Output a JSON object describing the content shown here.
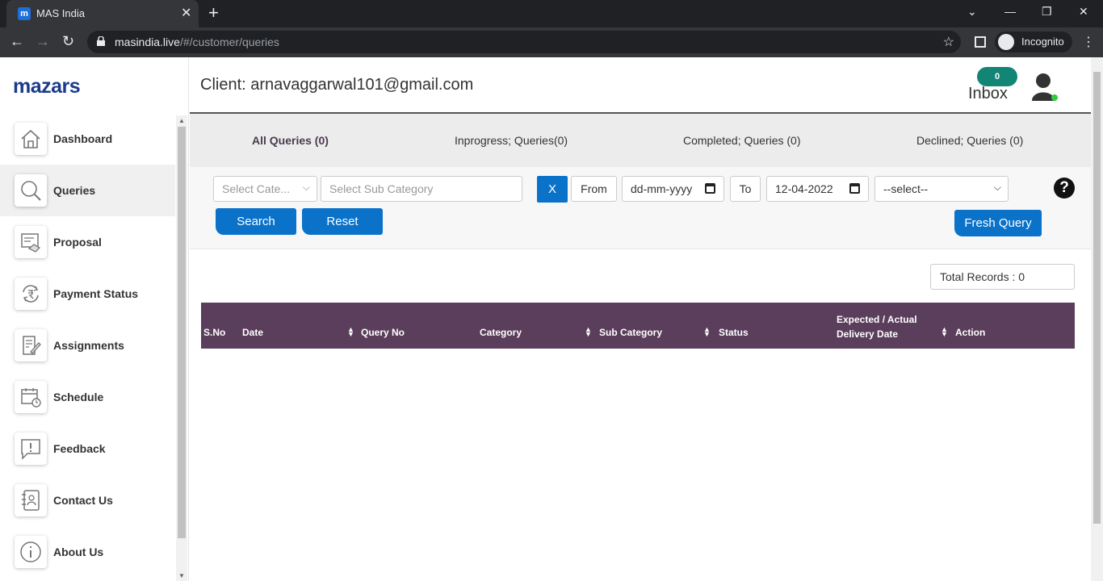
{
  "browser": {
    "tab_title": "MAS India",
    "url_host": "masindia.live",
    "url_path": "/#/customer/queries",
    "profile_label": "Incognito"
  },
  "sidebar": {
    "logo": "mazars",
    "items": [
      {
        "label": "Dashboard",
        "icon": "home-icon"
      },
      {
        "label": "Queries",
        "icon": "search-icon"
      },
      {
        "label": "Proposal",
        "icon": "proposal-icon"
      },
      {
        "label": "Payment Status",
        "icon": "rupee-refresh-icon"
      },
      {
        "label": "Assignments",
        "icon": "edit-document-icon"
      },
      {
        "label": "Schedule",
        "icon": "calendar-clock-icon"
      },
      {
        "label": "Feedback",
        "icon": "feedback-icon"
      },
      {
        "label": "Contact Us",
        "icon": "contact-book-icon"
      },
      {
        "label": "About Us",
        "icon": "info-icon"
      }
    ],
    "active": "Queries"
  },
  "header": {
    "client": "Client: arnavaggarwal101@gmail.com",
    "inbox_count": "0",
    "inbox_label": "Inbox"
  },
  "tabs": [
    {
      "label": "All Queries (0)",
      "active": true
    },
    {
      "label": "Inprogress; Queries(0)",
      "active": false
    },
    {
      "label": "Completed; Queries (0)",
      "active": false
    },
    {
      "label": "Declined; Queries (0)",
      "active": false
    }
  ],
  "filters": {
    "category_placeholder": "Select Cate...",
    "subcategory_placeholder": "Select Sub Category",
    "clear_label": "X",
    "from_label": "From",
    "from_value": "dd-mm-yyyy",
    "to_label": "To",
    "to_value": "12-04-2022",
    "status_select": "--select--",
    "search_label": "Search",
    "reset_label": "Reset",
    "fresh_query_label": "Fresh Query"
  },
  "total_records": "Total Records : 0",
  "table": {
    "columns": [
      "S.No",
      "Date",
      "Query No",
      "Category",
      "Sub Category",
      "Status",
      "Expected / Actual",
      "Delivery Date",
      "Action"
    ]
  },
  "colors": {
    "accent": "#0b72c9",
    "table_header": "#5a3e5b",
    "inbox_badge": "#138574"
  }
}
